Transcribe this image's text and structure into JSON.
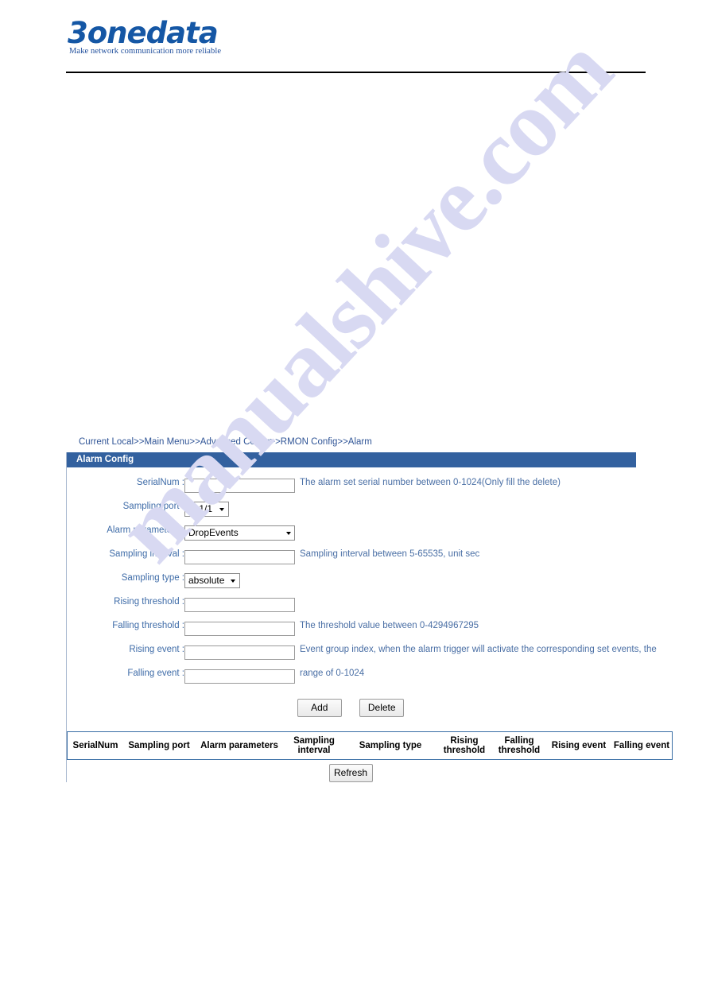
{
  "brand": {
    "logo_text": "3onedata",
    "tagline": "Make network communication more reliable"
  },
  "breadcrumb": "Current Local>>Main Menu>>Advanced Config>>RMON Config>>Alarm",
  "panel": {
    "title": "Alarm Config"
  },
  "watermark": {
    "text": "manualshive.com",
    "color": "#d8d9f2"
  },
  "colors": {
    "panel_header_bg": "#33619f",
    "label_text": "#3f6ca8",
    "hint_text": "#4a6fa5",
    "table_border": "#3a6ea5",
    "logo_blue": "#1557a5"
  },
  "form": {
    "fields": [
      {
        "label": "SerialNum :",
        "type": "text",
        "value": "",
        "placeholder": "",
        "hint": "The alarm set serial number between 0-1024(Only fill the delete)"
      },
      {
        "label": "Sampling port :",
        "type": "select",
        "value": "ge1/1",
        "hint": ""
      },
      {
        "label": "Alarm parameters :",
        "type": "select",
        "value": "DropEvents",
        "hint": ""
      },
      {
        "label": "Sampling interval :",
        "type": "text",
        "value": "",
        "placeholder": "",
        "hint": "Sampling interval between 5-65535, unit sec"
      },
      {
        "label": "Sampling type :",
        "type": "select",
        "value": "absolute",
        "hint": ""
      },
      {
        "label": "Rising threshold :",
        "type": "text",
        "value": "",
        "placeholder": "",
        "hint": ""
      },
      {
        "label": "Falling threshold :",
        "type": "text",
        "value": "",
        "placeholder": "",
        "hint": "The threshold value between 0-4294967295"
      },
      {
        "label": "Rising event :",
        "type": "text",
        "value": "",
        "placeholder": "",
        "hint": "Event group index, when the alarm trigger will activate the corresponding set events, the"
      },
      {
        "label": "Falling event :",
        "type": "text",
        "value": "",
        "placeholder": "",
        "hint": "range of 0-1024"
      }
    ]
  },
  "buttons": {
    "add": "Add",
    "delete": "Delete",
    "refresh": "Refresh"
  },
  "result_table": {
    "columns": [
      "SerialNum",
      "Sampling port",
      "Alarm parameters",
      "Sampling interval",
      "Sampling type",
      "Rising threshold",
      "Falling threshold",
      "Rising event",
      "Falling event"
    ],
    "rows": []
  }
}
